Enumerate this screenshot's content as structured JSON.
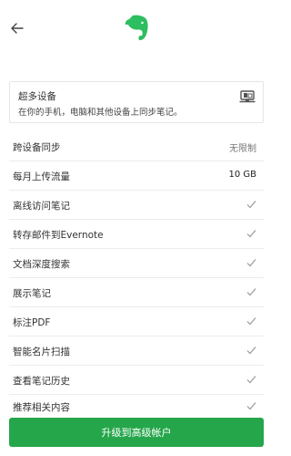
{
  "header": {
    "back_icon": "arrow-left-icon",
    "logo_icon": "evernote-elephant-icon",
    "brand_color": "#2dbe60"
  },
  "plan_card": {
    "title": "超多设备",
    "subtitle": "在你的手机，电脑和其他设备上同步笔记。",
    "icon": "devices-icon"
  },
  "features": [
    {
      "label": "跨设备同步",
      "value": "无限制"
    },
    {
      "label": "每月上传流量",
      "value": "10 GB"
    },
    {
      "label": "离线访问笔记",
      "check": "check-icon"
    },
    {
      "label": "转存邮件到Evernote",
      "check": "check-icon"
    },
    {
      "label": "文档深度搜索",
      "check": "check-icon"
    },
    {
      "label": "展示笔记",
      "check": "check-icon"
    },
    {
      "label": "标注PDF",
      "check": "check-icon"
    },
    {
      "label": "智能名片扫描",
      "check": "check-icon"
    },
    {
      "label": "查看笔记历史",
      "check": "check-icon"
    }
  ],
  "partial_feature": {
    "label": "推荐相关内容"
  },
  "footer": {
    "upgrade_label": "升级到高级帐户",
    "button_color": "#25a64a"
  }
}
